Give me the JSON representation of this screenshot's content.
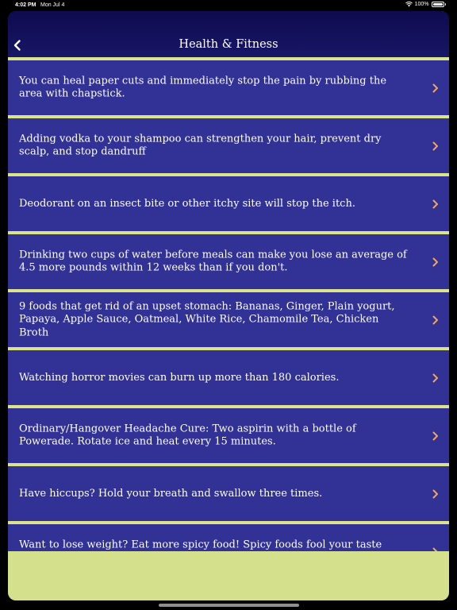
{
  "status_bar": {
    "time": "4:02 PM",
    "date": "Mon Jul 4",
    "battery": "100%"
  },
  "nav": {
    "title": "Health & Fitness",
    "back_icon": "chevron-left-icon"
  },
  "items": [
    {
      "text": "You can heal paper cuts and immediately stop the pain by rubbing the area with chapstick."
    },
    {
      "text": "Adding vodka to your shampoo can strengthen your hair, prevent dry scalp, and stop dandruff"
    },
    {
      "text": "Deodorant on an insect bite or other itchy site will stop the itch."
    },
    {
      "text": "Drinking two cups of water before meals can make you lose an average of 4.5 more pounds within 12 weeks than if you don't."
    },
    {
      "text": "9 foods that get rid of an upset stomach: Bananas, Ginger, Plain yogurt, Papaya, Apple Sauce, Oatmeal, White Rice, Chamomile Tea, Chicken Broth"
    },
    {
      "text": "Watching horror movies can burn up more than 180 calories."
    },
    {
      "text": "Ordinary/Hangover Headache Cure: Two aspirin with a bottle of Powerade. Rotate ice and heat every 15 minutes."
    },
    {
      "text": "Have hiccups? Hold your breath and swallow three times."
    },
    {
      "text": "Want to lose weight? Eat more spicy food! Spicy foods fool your taste buds into thinking you are full, which will cause you to eat less."
    }
  ],
  "colors": {
    "nav_background": "#0e0b4e",
    "row_background": "#313196",
    "separator": "#dbe48a",
    "chevron": "#f3a65c",
    "footer": "#d5e08c"
  }
}
